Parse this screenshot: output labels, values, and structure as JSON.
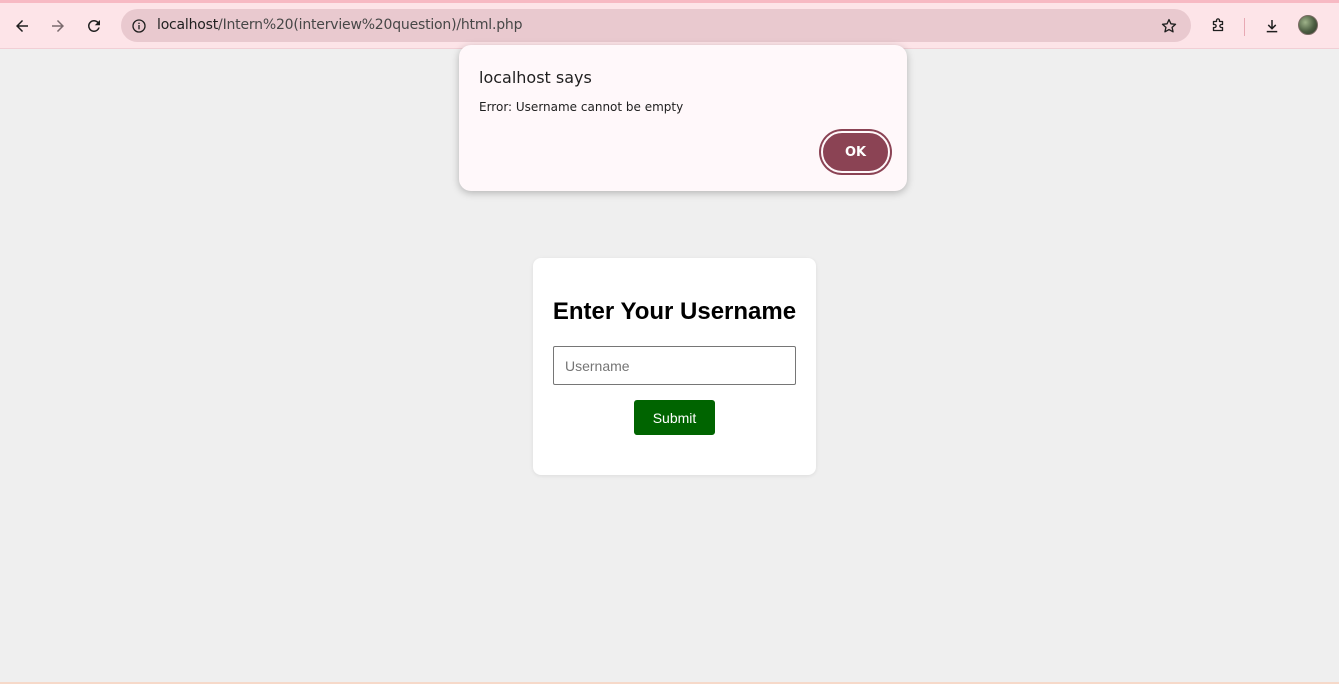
{
  "browser": {
    "url_host": "localhost",
    "url_path": "/Intern%20(interview%20question)/html.php",
    "icons": [
      "back-icon",
      "forward-icon",
      "reload-icon",
      "site-info-icon",
      "bookmark-star-icon",
      "extensions-icon",
      "download-icon",
      "profile-avatar"
    ]
  },
  "dialog": {
    "title": "localhost says",
    "message": "Error: Username cannot be empty",
    "ok_label": "OK"
  },
  "form": {
    "title": "Enter Your Username",
    "input_placeholder": "Username",
    "input_value": "",
    "submit_label": "Submit"
  },
  "colors": {
    "toolbar_bg": "#fde4e8",
    "omnibox_bg": "#e9c9cf",
    "page_bg": "#efefef",
    "submit_bg": "#006400",
    "ok_bg": "#8b4354"
  }
}
